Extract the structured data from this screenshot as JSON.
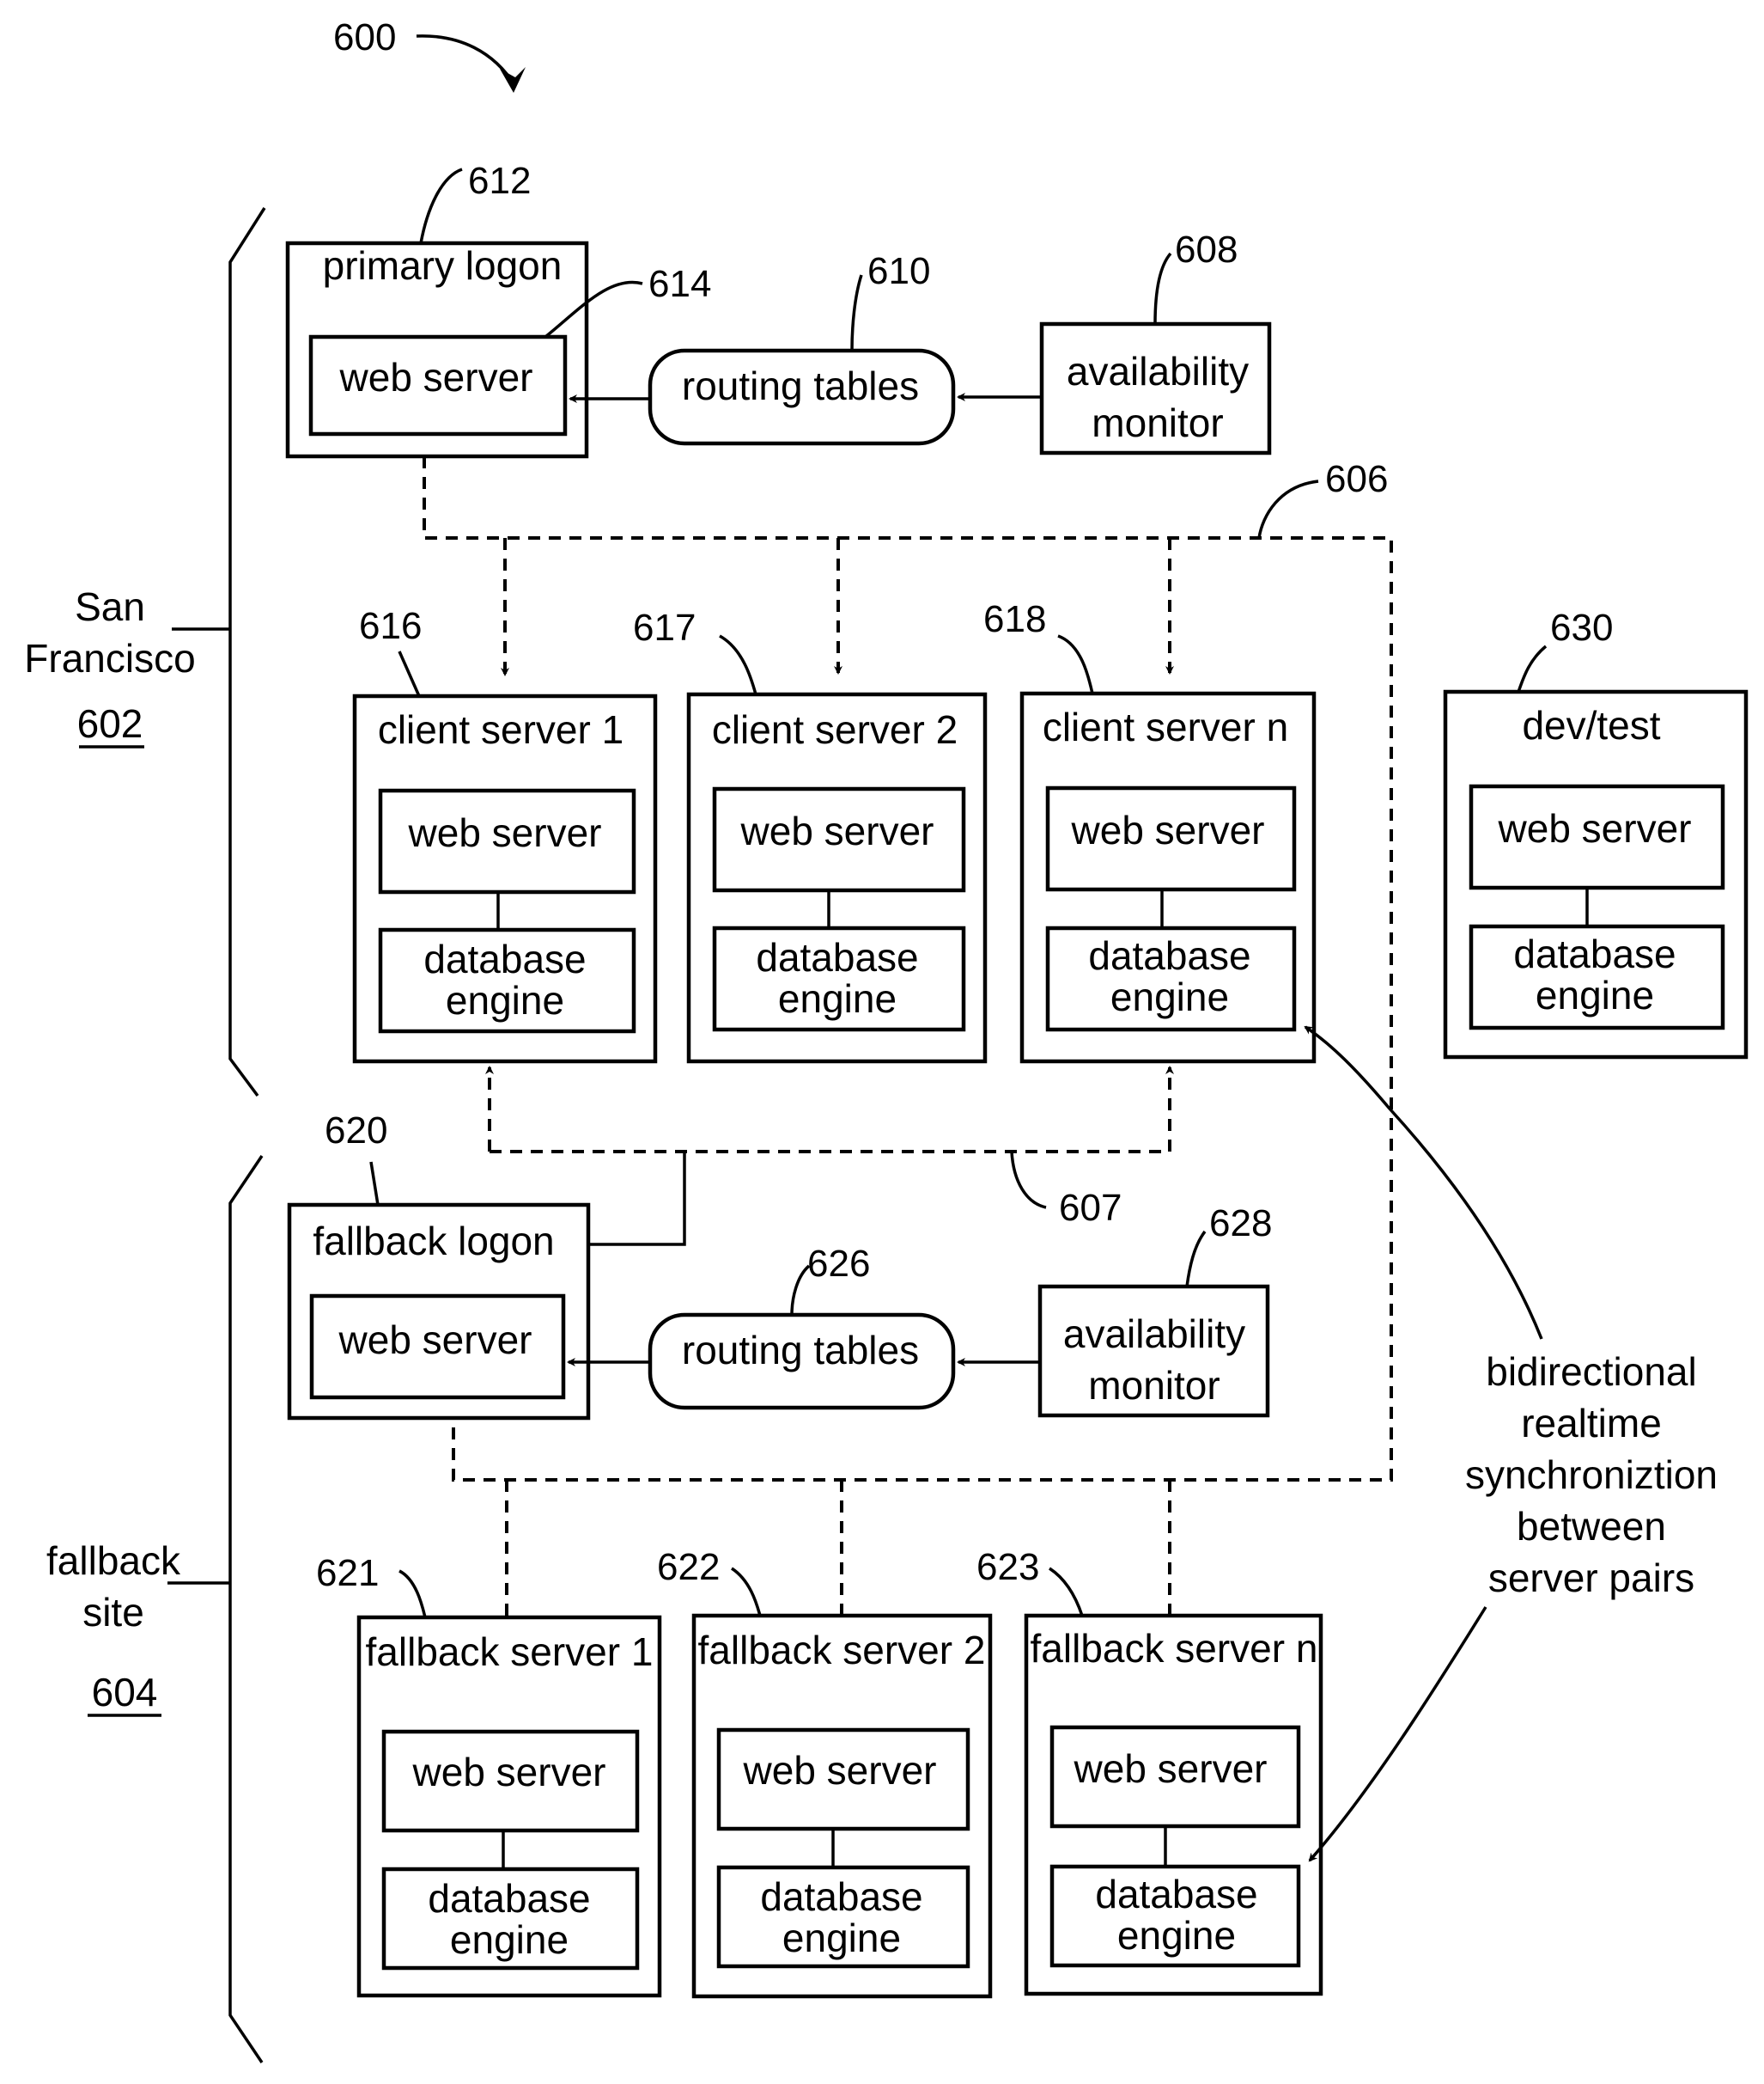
{
  "figure": {
    "ref": "600",
    "sites": {
      "primary": {
        "name_line1": "San",
        "name_line2": "Francisco",
        "ref": "602"
      },
      "fallback": {
        "name_line1": "fallback",
        "name_line2": "site",
        "ref": "604"
      }
    },
    "primary_logon": {
      "title": "primary logon",
      "ref": "612",
      "web_server": "web server",
      "web_server_ref": "614"
    },
    "routing_tables_primary": {
      "label": "routing tables",
      "ref": "610"
    },
    "availability_monitor_primary": {
      "line1": "availability",
      "line2": "monitor",
      "ref": "608"
    },
    "bus_primary_ref": "606",
    "bus_fallback_ref": "607",
    "client_servers": [
      {
        "title": "client server 1",
        "ref": "616",
        "web": "web server",
        "db1": "database",
        "db2": "engine"
      },
      {
        "title": "client server 2",
        "ref": "617",
        "web": "web server",
        "db1": "database",
        "db2": "engine"
      },
      {
        "title": "client server n",
        "ref": "618",
        "web": "web server",
        "db1": "database",
        "db2": "engine"
      }
    ],
    "dev_test": {
      "title": "dev/test",
      "ref": "630",
      "web": "web server",
      "db1": "database",
      "db2": "engine"
    },
    "fallback_logon": {
      "title": "fallback logon",
      "ref": "620",
      "web_server": "web server"
    },
    "routing_tables_fallback": {
      "label": "routing tables",
      "ref": "626"
    },
    "availability_monitor_fallback": {
      "line1": "availability",
      "line2": "monitor",
      "ref": "628"
    },
    "fallback_servers": [
      {
        "title": "fallback server 1",
        "ref": "621",
        "web": "web server",
        "db1": "database",
        "db2": "engine"
      },
      {
        "title": "fallback server 2",
        "ref": "622",
        "web": "web server",
        "db1": "database",
        "db2": "engine"
      },
      {
        "title": "fallback server n",
        "ref": "623",
        "web": "web server",
        "db1": "database",
        "db2": "engine"
      }
    ],
    "sync_note": [
      "bidirectional",
      "realtime",
      "synchroniztion",
      "between",
      "server pairs"
    ]
  }
}
